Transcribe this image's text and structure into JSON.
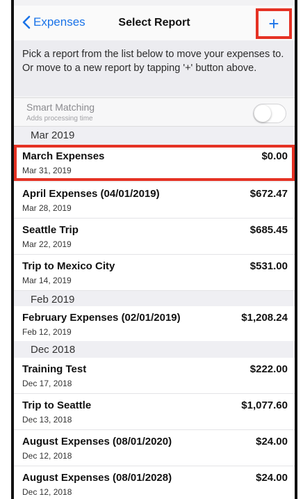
{
  "navbar": {
    "back_label": "Expenses",
    "title": "Select Report",
    "add_label": "+"
  },
  "intro": {
    "text": "Pick a report from the list below to move your expenses to. Or move to a new report by tapping '+' button above."
  },
  "smart_matching": {
    "label": "Smart Matching",
    "sub": "Adds processing time",
    "enabled": false
  },
  "sections": [
    {
      "label": "Mar 2019"
    },
    {
      "label": "Feb 2019"
    },
    {
      "label": "Dec 2018"
    }
  ],
  "reports": [
    {
      "name": "March Expenses",
      "date": "Mar 31, 2019",
      "amount": "$0.00"
    },
    {
      "name": "April Expenses (04/01/2019)",
      "date": "Mar 28, 2019",
      "amount": "$672.47"
    },
    {
      "name": "Seattle Trip",
      "date": "Mar 22, 2019",
      "amount": "$685.45"
    },
    {
      "name": "Trip to Mexico City",
      "date": "Mar 14, 2019",
      "amount": "$531.00"
    },
    {
      "name": "February Expenses (02/01/2019)",
      "date": "Feb 12, 2019",
      "amount": "$1,208.24"
    },
    {
      "name": "Training Test",
      "date": "Dec 17, 2018",
      "amount": "$222.00"
    },
    {
      "name": "Trip to Seattle",
      "date": "Dec 13, 2018",
      "amount": "$1,077.60"
    },
    {
      "name": "August Expenses (08/01/2020)",
      "date": "Dec 12, 2018",
      "amount": "$24.00"
    },
    {
      "name": "August Expenses (08/01/2028)",
      "date": "Dec 12, 2018",
      "amount": "$24.00"
    }
  ],
  "colors": {
    "accent": "#1a73e8",
    "highlight": "#e53224"
  },
  "icons": {
    "back": "chevron-left-icon",
    "add": "plus-icon"
  }
}
